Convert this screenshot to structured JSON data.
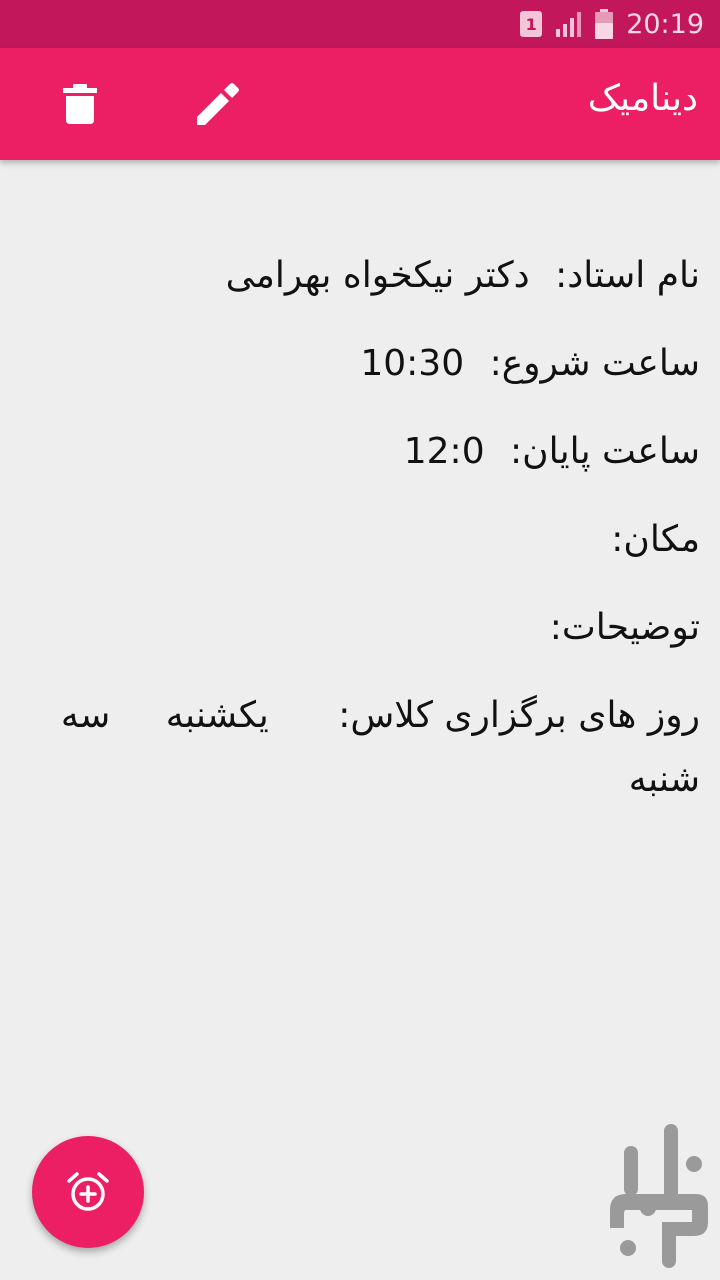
{
  "status_bar": {
    "sim_label": "1",
    "time": "20:19",
    "icons": [
      "sim-icon",
      "signal-icon",
      "battery-icon"
    ]
  },
  "app_bar": {
    "title": "دینامیک",
    "actions": [
      "delete-icon",
      "edit-icon"
    ]
  },
  "details": {
    "teacher_label": "نام استاد:",
    "teacher_value": "دکتر نیکخواه بهرامی",
    "start_label": "ساعت شروع:",
    "start_value": "10:30",
    "end_label": "ساعت پایان:",
    "end_value": "12:0",
    "location_label": "مکان:",
    "location_value": "",
    "notes_label": "توضیحات:",
    "notes_value": "",
    "days_label": "روز های برگزاری کلاس:",
    "days": [
      "یکشنبه",
      "سه شنبه"
    ]
  },
  "fab": {
    "icon": "add-alarm-icon"
  },
  "watermark": {
    "icon": "bazaar-logo-icon"
  },
  "colors": {
    "status_bar": "#c2185b",
    "primary": "#ec1f65",
    "background": "#eeeeee",
    "text": "#111111"
  }
}
